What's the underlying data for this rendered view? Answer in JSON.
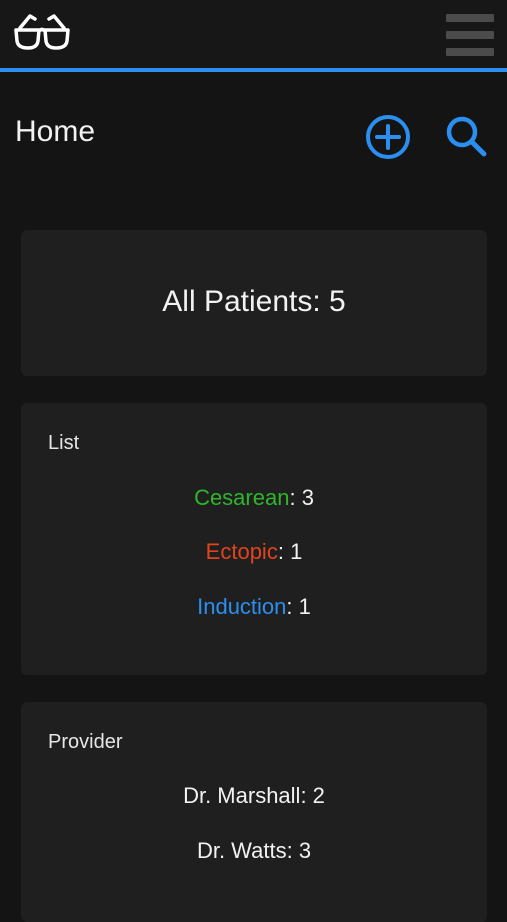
{
  "header": {
    "logo_icon": "glasses-icon",
    "menu_icon": "hamburger-menu-icon",
    "accent_color": "#2a8ff0"
  },
  "page": {
    "title": "Home",
    "add_icon": "plus-circle-icon",
    "search_icon": "search-icon"
  },
  "summary": {
    "label": "All Patients",
    "separator": ": ",
    "count": "5"
  },
  "list_card": {
    "heading": "List",
    "items": [
      {
        "name": "Cesarean",
        "separator": ": ",
        "count": "3",
        "color": "#2fb52c"
      },
      {
        "name": "Ectopic",
        "separator": ": ",
        "count": "1",
        "color": "#e0441f"
      },
      {
        "name": "Induction",
        "separator": ": ",
        "count": "1",
        "color": "#2a8ff0"
      }
    ]
  },
  "provider_card": {
    "heading": "Provider",
    "items": [
      {
        "name": "Dr. Marshall",
        "separator": ": ",
        "count": "2"
      },
      {
        "name": "Dr. Watts",
        "separator": ": ",
        "count": "3"
      }
    ]
  }
}
